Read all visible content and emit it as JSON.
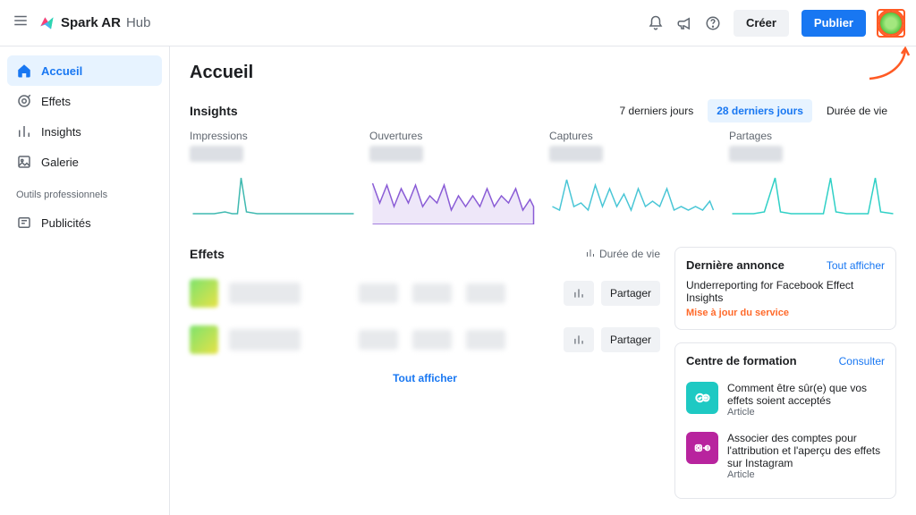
{
  "brand": {
    "name": "Spark AR",
    "suffix": "Hub"
  },
  "topbar": {
    "create": "Créer",
    "publish": "Publier"
  },
  "sidebar": {
    "items": [
      {
        "label": "Accueil"
      },
      {
        "label": "Effets"
      },
      {
        "label": "Insights"
      },
      {
        "label": "Galerie"
      }
    ],
    "section_pro": "Outils professionnels",
    "pro_items": [
      {
        "label": "Publicités"
      }
    ]
  },
  "page": {
    "title": "Accueil"
  },
  "insights": {
    "title": "Insights",
    "tabs": {
      "t7": "7 derniers jours",
      "t28": "28 derniers jours",
      "life": "Durée de vie"
    },
    "cards": {
      "impressions": "Impressions",
      "opens": "Ouvertures",
      "captures": "Captures",
      "shares": "Partages"
    }
  },
  "effects": {
    "title": "Effets",
    "lifetime": "Durée de vie",
    "share": "Partager",
    "show_all": "Tout afficher"
  },
  "announcement": {
    "title": "Dernière annonce",
    "show_all": "Tout afficher",
    "item_title": "Underreporting for Facebook Effect Insights",
    "item_tag": "Mise à jour du service"
  },
  "education": {
    "title": "Centre de formation",
    "link": "Consulter",
    "items": [
      {
        "title": "Comment être sûr(e) que vos effets soient acceptés",
        "sub": "Article"
      },
      {
        "title": "Associer des comptes pour l'attribution et l'aperçu des effets sur Instagram",
        "sub": "Article"
      }
    ]
  },
  "chart_data": [
    {
      "type": "line",
      "title": "Impressions",
      "color": "#3fb9b0",
      "values": [
        2,
        2,
        2,
        3,
        2,
        2,
        2,
        2,
        10,
        3,
        2,
        2,
        2,
        2,
        2,
        2,
        2,
        2,
        2,
        2,
        2,
        2,
        2,
        2,
        2,
        2,
        2,
        2,
        2,
        2
      ],
      "ylim": [
        0,
        12
      ]
    },
    {
      "type": "area",
      "title": "Ouvertures",
      "color": "#8a5cd6",
      "values": [
        9,
        5,
        8,
        4,
        7,
        5,
        8,
        4,
        6,
        5,
        8,
        3,
        6,
        4,
        6,
        4,
        7,
        4,
        6,
        5,
        7,
        3,
        5,
        4,
        5,
        4,
        5,
        3,
        5,
        4
      ],
      "ylim": [
        0,
        12
      ]
    },
    {
      "type": "line",
      "title": "Captures",
      "color": "#49c6d6",
      "values": [
        4,
        3,
        10,
        4,
        5,
        3,
        8,
        4,
        7,
        4,
        6,
        3,
        7,
        4,
        5,
        4,
        7,
        3,
        4,
        3,
        4,
        3,
        5,
        4,
        6,
        3,
        4,
        3,
        4,
        3
      ],
      "ylim": [
        0,
        12
      ]
    },
    {
      "type": "line",
      "title": "Partages",
      "color": "#2fd0c6",
      "values": [
        2,
        2,
        2,
        2,
        3,
        2,
        2,
        2,
        10,
        3,
        2,
        2,
        2,
        2,
        2,
        2,
        2,
        2,
        2,
        10,
        3,
        2,
        2,
        2,
        2,
        2,
        2,
        10,
        3,
        2
      ],
      "ylim": [
        0,
        12
      ]
    }
  ]
}
